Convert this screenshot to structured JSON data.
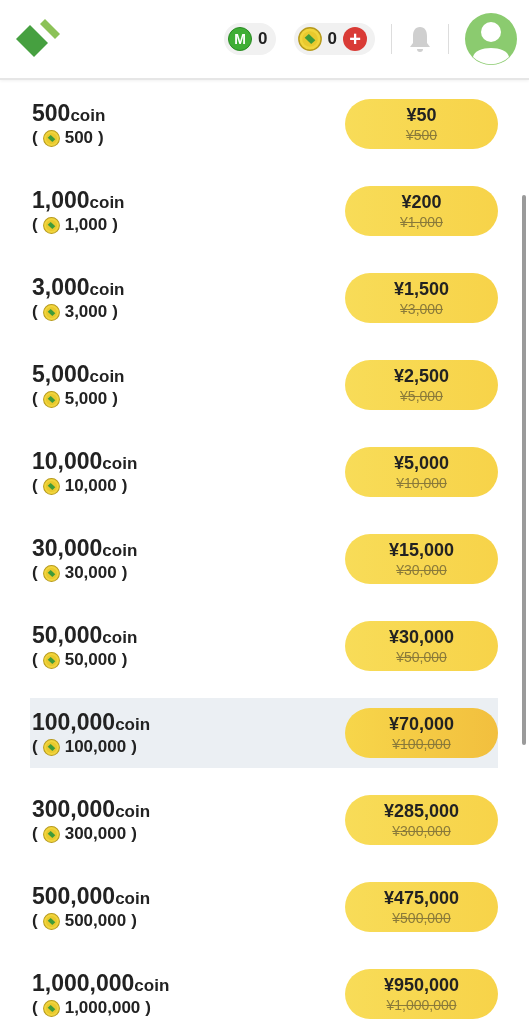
{
  "header": {
    "m_badge": {
      "letter": "M",
      "count": "0"
    },
    "coin_badge": {
      "count": "0",
      "plus": "+"
    }
  },
  "packs": [
    {
      "amount": "500",
      "unit": "coin",
      "open": "(",
      "bonus": "500",
      "close": ")",
      "price": "¥50",
      "original": "¥500",
      "selected": false
    },
    {
      "amount": "1,000",
      "unit": "coin",
      "open": "(",
      "bonus": "1,000",
      "close": ")",
      "price": "¥200",
      "original": "¥1,000",
      "selected": false
    },
    {
      "amount": "3,000",
      "unit": "coin",
      "open": "(",
      "bonus": "3,000",
      "close": ")",
      "price": "¥1,500",
      "original": "¥3,000",
      "selected": false
    },
    {
      "amount": "5,000",
      "unit": "coin",
      "open": "(",
      "bonus": "5,000",
      "close": ")",
      "price": "¥2,500",
      "original": "¥5,000",
      "selected": false
    },
    {
      "amount": "10,000",
      "unit": "coin",
      "open": "(",
      "bonus": "10,000",
      "close": ")",
      "price": "¥5,000",
      "original": "¥10,000",
      "selected": false
    },
    {
      "amount": "30,000",
      "unit": "coin",
      "open": "(",
      "bonus": "30,000",
      "close": ")",
      "price": "¥15,000",
      "original": "¥30,000",
      "selected": false
    },
    {
      "amount": "50,000",
      "unit": "coin",
      "open": "(",
      "bonus": "50,000",
      "close": ")",
      "price": "¥30,000",
      "original": "¥50,000",
      "selected": false
    },
    {
      "amount": "100,000",
      "unit": "coin",
      "open": "(",
      "bonus": "100,000",
      "close": ")",
      "price": "¥70,000",
      "original": "¥100,000",
      "selected": true
    },
    {
      "amount": "300,000",
      "unit": "coin",
      "open": "(",
      "bonus": "300,000",
      "close": ")",
      "price": "¥285,000",
      "original": "¥300,000",
      "selected": false
    },
    {
      "amount": "500,000",
      "unit": "coin",
      "open": "(",
      "bonus": "500,000",
      "close": ")",
      "price": "¥475,000",
      "original": "¥500,000",
      "selected": false
    },
    {
      "amount": "1,000,000",
      "unit": "coin",
      "open": "(",
      "bonus": "1,000,000",
      "close": ")",
      "price": "¥950,000",
      "original": "¥1,000,000",
      "selected": false
    }
  ]
}
